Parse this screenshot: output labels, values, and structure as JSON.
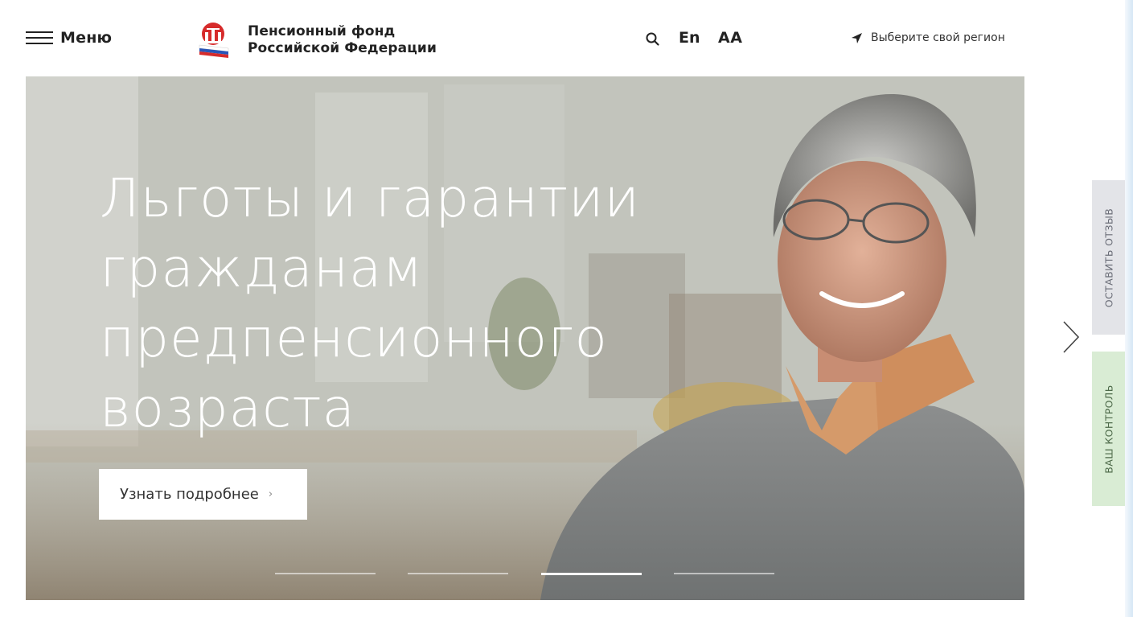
{
  "header": {
    "menu_label": "Меню",
    "org_name_line1": "Пенсионный фонд",
    "org_name_line2": "Российской Федерации",
    "lang_label": "En",
    "font_size_label": "AA",
    "region_label": "Выберите свой регион"
  },
  "hero": {
    "title_lines": [
      "Льготы и гарантии",
      "гражданам",
      "предпенсионного",
      "возраста"
    ],
    "button_label": "Узнать подробнее",
    "button_arrow": "›",
    "slides_total": 4,
    "active_slide": 3
  },
  "side_tabs": {
    "feedback_label": "ОСТАВИТЬ ОТЗЫВ",
    "control_label": "ВАШ КОНТРОЛЬ"
  },
  "icons": {
    "menu": "hamburger-icon",
    "logo": "pfr-logo-icon",
    "search": "search-icon",
    "region": "location-arrow-icon",
    "next": "chevron-right-icon"
  },
  "colors": {
    "text_dark": "#222222",
    "feedback_tab_bg": "#e3e4e8",
    "control_tab_bg": "#d9ecd4",
    "logo_red": "#d62b2b",
    "logo_blue": "#2a56b8"
  }
}
